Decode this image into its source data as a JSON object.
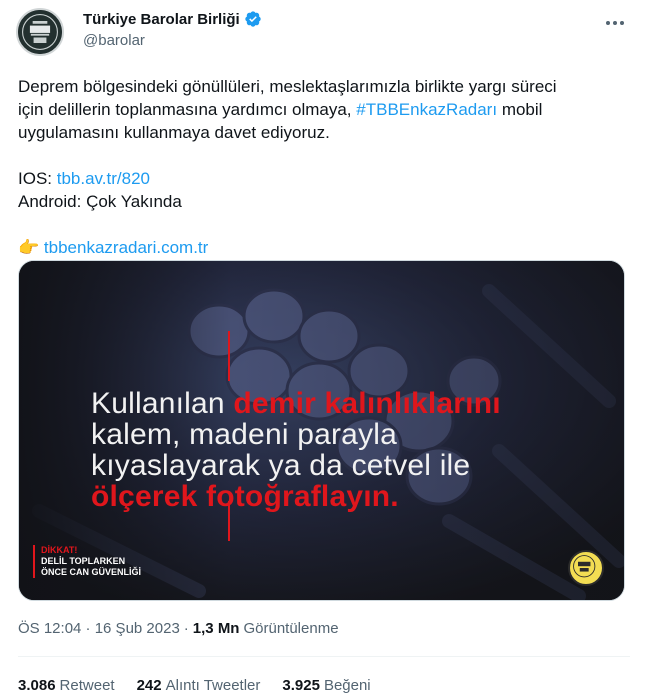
{
  "account": {
    "display_name": "Türkiye Barolar Birliği",
    "handle": "@barolar",
    "verified": true,
    "avatar_icon": "tbb-logo-icon"
  },
  "tweet": {
    "line1": "Deprem bölgesindeki gönüllüleri, meslektaşlarımızla birlikte yargı süreci",
    "line2_prefix": "için delillerin toplanmasına yardımcı olmaya,",
    "hashtag": "#TBBEnkazRadarı",
    "line2_suffix": "mobil",
    "line3": "uygulamasını kullanmaya davet ediyoruz.",
    "ios_label": "IOS:",
    "ios_link": "tbb.av.tr/820",
    "android_label": "Android:",
    "android_value": "Çok Yakında",
    "pointer_emoji": "👉",
    "website_link": "tbbenkazradari.com.tr"
  },
  "media": {
    "text_line1_white": "Kullanılan",
    "text_line1_red": "demir kalınlıklarını",
    "text_line2": "kalem, madeni parayla",
    "text_line3": "kıyaslayarak ya da cetvel ile",
    "text_line4": "ölçerek fotoğraflayın.",
    "warning_title": "DİKKAT!",
    "warning_line1": "DELİL TOPLARKEN",
    "warning_line2": "ÖNCE CAN GÜVENLİĞİ",
    "accent_color": "#e0161c"
  },
  "meta": {
    "timestamp": "ÖS 12:04 · 16 Şub 2023",
    "separator": "·",
    "views_count": "1,3 Mn",
    "views_label": "Görüntülenme"
  },
  "stats": {
    "retweets_count": "3.086",
    "retweets_label": "Retweet",
    "quotes_count": "242",
    "quotes_label": "Alıntı Tweetler",
    "likes_count": "3.925",
    "likes_label": "Beğeni"
  },
  "colors": {
    "link": "#1d9bf0",
    "secondary_text": "#536471",
    "primary_text": "#0f1419"
  }
}
